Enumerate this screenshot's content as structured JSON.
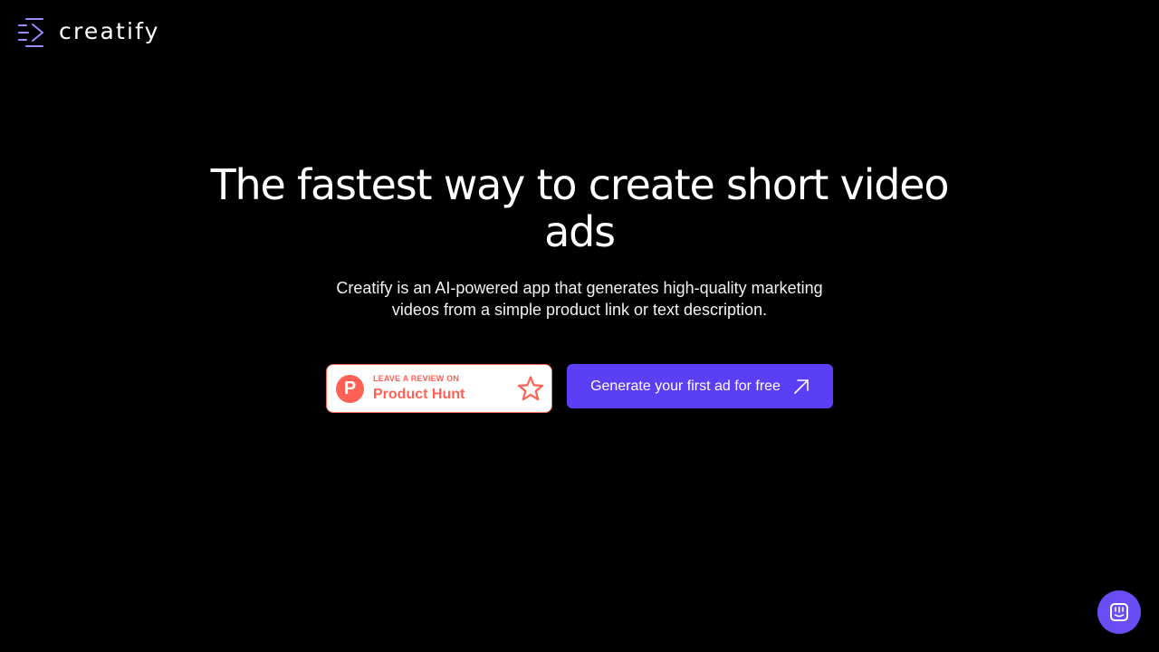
{
  "header": {
    "logo_text": "creatify"
  },
  "hero": {
    "headline": "The fastest way to create short video ads",
    "subheadline": "Creatify is an AI-powered app that generates high-quality marketing videos from a simple product link or text description."
  },
  "product_hunt_badge": {
    "logo_letter": "P",
    "kicker": "LEAVE A REVIEW ON",
    "title": "Product Hunt",
    "icon": "star-icon",
    "color": "#ff6154"
  },
  "cta": {
    "label": "Generate your first ad for free",
    "icon": "arrow-up-right-icon",
    "color": "#5b3ff5"
  },
  "chat_launcher": {
    "icon": "chat-icon",
    "color": "#6b4df5"
  },
  "colors": {
    "background": "#000000",
    "text": "#ffffff",
    "logo_accent": "#9b8cff"
  }
}
